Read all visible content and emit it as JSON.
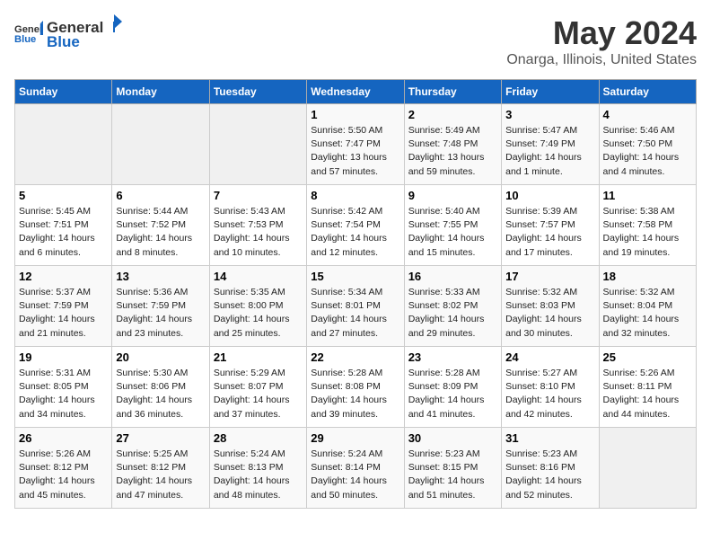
{
  "header": {
    "logo_general": "General",
    "logo_blue": "Blue",
    "title": "May 2024",
    "subtitle": "Onarga, Illinois, United States"
  },
  "weekdays": [
    "Sunday",
    "Monday",
    "Tuesday",
    "Wednesday",
    "Thursday",
    "Friday",
    "Saturday"
  ],
  "weeks": [
    [
      {
        "day": "",
        "empty": true
      },
      {
        "day": "",
        "empty": true
      },
      {
        "day": "",
        "empty": true
      },
      {
        "day": "1",
        "sunrise": "Sunrise: 5:50 AM",
        "sunset": "Sunset: 7:47 PM",
        "daylight": "Daylight: 13 hours and 57 minutes."
      },
      {
        "day": "2",
        "sunrise": "Sunrise: 5:49 AM",
        "sunset": "Sunset: 7:48 PM",
        "daylight": "Daylight: 13 hours and 59 minutes."
      },
      {
        "day": "3",
        "sunrise": "Sunrise: 5:47 AM",
        "sunset": "Sunset: 7:49 PM",
        "daylight": "Daylight: 14 hours and 1 minute."
      },
      {
        "day": "4",
        "sunrise": "Sunrise: 5:46 AM",
        "sunset": "Sunset: 7:50 PM",
        "daylight": "Daylight: 14 hours and 4 minutes."
      }
    ],
    [
      {
        "day": "5",
        "sunrise": "Sunrise: 5:45 AM",
        "sunset": "Sunset: 7:51 PM",
        "daylight": "Daylight: 14 hours and 6 minutes."
      },
      {
        "day": "6",
        "sunrise": "Sunrise: 5:44 AM",
        "sunset": "Sunset: 7:52 PM",
        "daylight": "Daylight: 14 hours and 8 minutes."
      },
      {
        "day": "7",
        "sunrise": "Sunrise: 5:43 AM",
        "sunset": "Sunset: 7:53 PM",
        "daylight": "Daylight: 14 hours and 10 minutes."
      },
      {
        "day": "8",
        "sunrise": "Sunrise: 5:42 AM",
        "sunset": "Sunset: 7:54 PM",
        "daylight": "Daylight: 14 hours and 12 minutes."
      },
      {
        "day": "9",
        "sunrise": "Sunrise: 5:40 AM",
        "sunset": "Sunset: 7:55 PM",
        "daylight": "Daylight: 14 hours and 15 minutes."
      },
      {
        "day": "10",
        "sunrise": "Sunrise: 5:39 AM",
        "sunset": "Sunset: 7:57 PM",
        "daylight": "Daylight: 14 hours and 17 minutes."
      },
      {
        "day": "11",
        "sunrise": "Sunrise: 5:38 AM",
        "sunset": "Sunset: 7:58 PM",
        "daylight": "Daylight: 14 hours and 19 minutes."
      }
    ],
    [
      {
        "day": "12",
        "sunrise": "Sunrise: 5:37 AM",
        "sunset": "Sunset: 7:59 PM",
        "daylight": "Daylight: 14 hours and 21 minutes."
      },
      {
        "day": "13",
        "sunrise": "Sunrise: 5:36 AM",
        "sunset": "Sunset: 7:59 PM",
        "daylight": "Daylight: 14 hours and 23 minutes."
      },
      {
        "day": "14",
        "sunrise": "Sunrise: 5:35 AM",
        "sunset": "Sunset: 8:00 PM",
        "daylight": "Daylight: 14 hours and 25 minutes."
      },
      {
        "day": "15",
        "sunrise": "Sunrise: 5:34 AM",
        "sunset": "Sunset: 8:01 PM",
        "daylight": "Daylight: 14 hours and 27 minutes."
      },
      {
        "day": "16",
        "sunrise": "Sunrise: 5:33 AM",
        "sunset": "Sunset: 8:02 PM",
        "daylight": "Daylight: 14 hours and 29 minutes."
      },
      {
        "day": "17",
        "sunrise": "Sunrise: 5:32 AM",
        "sunset": "Sunset: 8:03 PM",
        "daylight": "Daylight: 14 hours and 30 minutes."
      },
      {
        "day": "18",
        "sunrise": "Sunrise: 5:32 AM",
        "sunset": "Sunset: 8:04 PM",
        "daylight": "Daylight: 14 hours and 32 minutes."
      }
    ],
    [
      {
        "day": "19",
        "sunrise": "Sunrise: 5:31 AM",
        "sunset": "Sunset: 8:05 PM",
        "daylight": "Daylight: 14 hours and 34 minutes."
      },
      {
        "day": "20",
        "sunrise": "Sunrise: 5:30 AM",
        "sunset": "Sunset: 8:06 PM",
        "daylight": "Daylight: 14 hours and 36 minutes."
      },
      {
        "day": "21",
        "sunrise": "Sunrise: 5:29 AM",
        "sunset": "Sunset: 8:07 PM",
        "daylight": "Daylight: 14 hours and 37 minutes."
      },
      {
        "day": "22",
        "sunrise": "Sunrise: 5:28 AM",
        "sunset": "Sunset: 8:08 PM",
        "daylight": "Daylight: 14 hours and 39 minutes."
      },
      {
        "day": "23",
        "sunrise": "Sunrise: 5:28 AM",
        "sunset": "Sunset: 8:09 PM",
        "daylight": "Daylight: 14 hours and 41 minutes."
      },
      {
        "day": "24",
        "sunrise": "Sunrise: 5:27 AM",
        "sunset": "Sunset: 8:10 PM",
        "daylight": "Daylight: 14 hours and 42 minutes."
      },
      {
        "day": "25",
        "sunrise": "Sunrise: 5:26 AM",
        "sunset": "Sunset: 8:11 PM",
        "daylight": "Daylight: 14 hours and 44 minutes."
      }
    ],
    [
      {
        "day": "26",
        "sunrise": "Sunrise: 5:26 AM",
        "sunset": "Sunset: 8:12 PM",
        "daylight": "Daylight: 14 hours and 45 minutes."
      },
      {
        "day": "27",
        "sunrise": "Sunrise: 5:25 AM",
        "sunset": "Sunset: 8:12 PM",
        "daylight": "Daylight: 14 hours and 47 minutes."
      },
      {
        "day": "28",
        "sunrise": "Sunrise: 5:24 AM",
        "sunset": "Sunset: 8:13 PM",
        "daylight": "Daylight: 14 hours and 48 minutes."
      },
      {
        "day": "29",
        "sunrise": "Sunrise: 5:24 AM",
        "sunset": "Sunset: 8:14 PM",
        "daylight": "Daylight: 14 hours and 50 minutes."
      },
      {
        "day": "30",
        "sunrise": "Sunrise: 5:23 AM",
        "sunset": "Sunset: 8:15 PM",
        "daylight": "Daylight: 14 hours and 51 minutes."
      },
      {
        "day": "31",
        "sunrise": "Sunrise: 5:23 AM",
        "sunset": "Sunset: 8:16 PM",
        "daylight": "Daylight: 14 hours and 52 minutes."
      },
      {
        "day": "",
        "empty": true
      }
    ]
  ]
}
